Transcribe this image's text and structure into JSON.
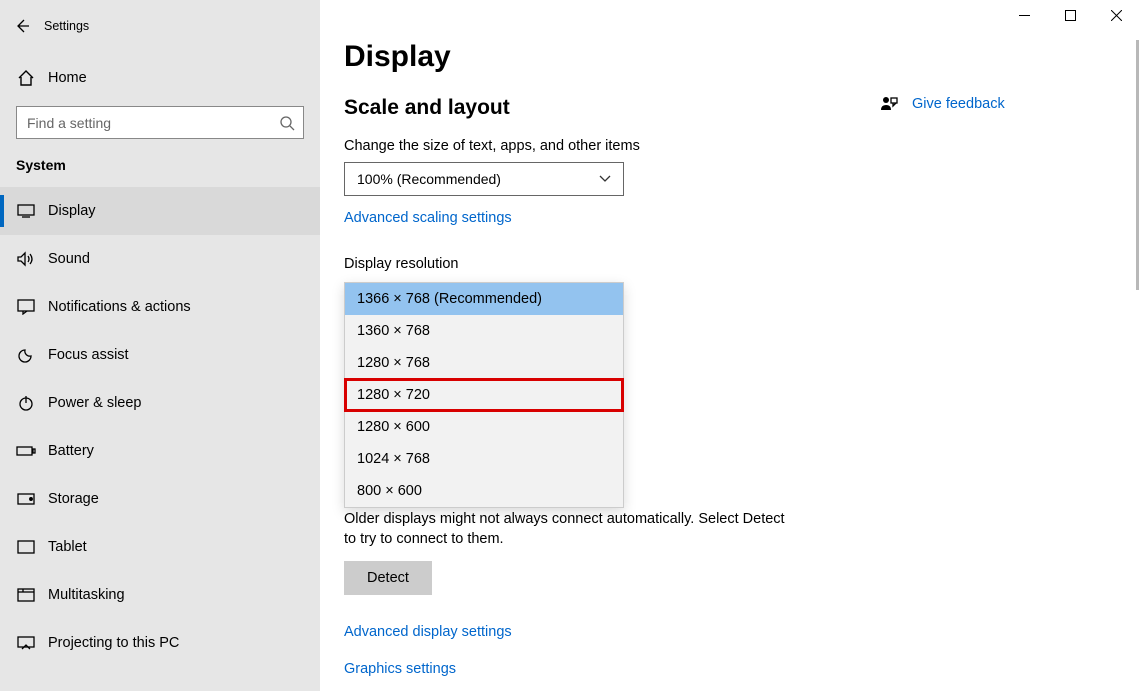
{
  "window": {
    "title": "Settings"
  },
  "sidebar": {
    "home_label": "Home",
    "search_placeholder": "Find a setting",
    "category": "System",
    "items": [
      {
        "label": "Display"
      },
      {
        "label": "Sound"
      },
      {
        "label": "Notifications & actions"
      },
      {
        "label": "Focus assist"
      },
      {
        "label": "Power & sleep"
      },
      {
        "label": "Battery"
      },
      {
        "label": "Storage"
      },
      {
        "label": "Tablet"
      },
      {
        "label": "Multitasking"
      },
      {
        "label": "Projecting to this PC"
      }
    ]
  },
  "main": {
    "page_title": "Display",
    "section_title": "Scale and layout",
    "scale_label": "Change the size of text, apps, and other items",
    "scale_value": "100% (Recommended)",
    "advanced_scaling_link": "Advanced scaling settings",
    "resolution_label": "Display resolution",
    "resolution_options": [
      "1366 × 768 (Recommended)",
      "1360 × 768",
      "1280 × 768",
      "1280 × 720",
      "1280 × 600",
      "1024 × 768",
      "800 × 600"
    ],
    "resolution_selected_index": 0,
    "resolution_highlight_index": 3,
    "detect_text": "Older displays might not always connect automatically. Select Detect to try to connect to them.",
    "detect_button": "Detect",
    "advanced_display_link": "Advanced display settings",
    "graphics_link": "Graphics settings"
  },
  "feedback": {
    "label": "Give feedback"
  }
}
